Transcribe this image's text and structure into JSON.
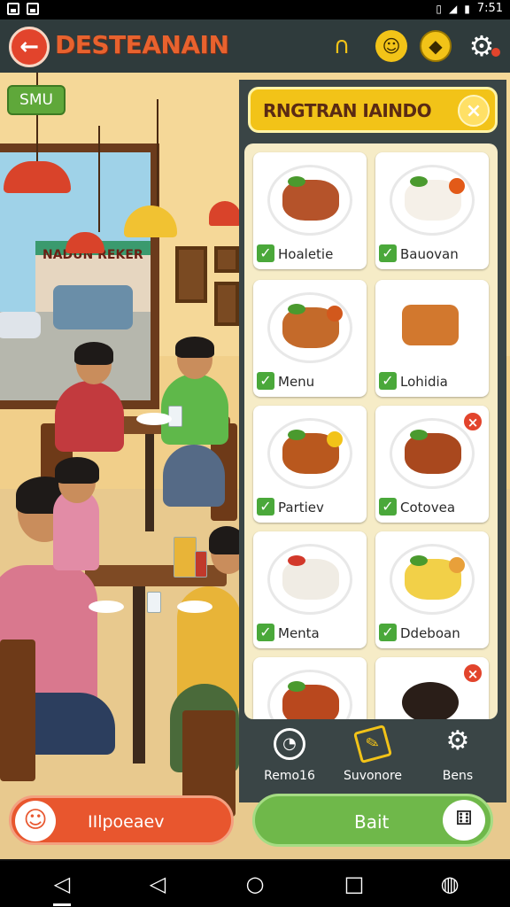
{
  "status_bar": {
    "time": "7:51",
    "icons": [
      "image-icon",
      "app-icon",
      "vibrate-icon",
      "signal-icon",
      "battery-icon"
    ]
  },
  "header": {
    "title": "DESTEANAIN",
    "icons": [
      "back-arrow-icon",
      "headphones-icon",
      "smile-icon",
      "tag-icon",
      "gear-icon"
    ],
    "badge_color": "#e2442c",
    "accent": "#e8622e"
  },
  "scene": {
    "sign_label": "SMU",
    "shop_sign": "NADUN REKER"
  },
  "panel": {
    "title": "RNGTRAN IAINDO",
    "close_label": "×",
    "items": [
      {
        "label": "Hoaletie",
        "removable": false
      },
      {
        "label": "Bauovan",
        "removable": false
      },
      {
        "label": "Menu",
        "removable": false
      },
      {
        "label": "Lohidia",
        "removable": false
      },
      {
        "label": "Partiev",
        "removable": false
      },
      {
        "label": "Cotovea",
        "removable": true
      },
      {
        "label": "Menta",
        "removable": false
      },
      {
        "label": "Ddeboan",
        "removable": false
      },
      {
        "label": "",
        "removable": false
      },
      {
        "label": "",
        "removable": true
      }
    ],
    "tools": [
      {
        "label": "Remo16",
        "icon": "clock-icon"
      },
      {
        "label": "Suvonore",
        "icon": "card-icon"
      },
      {
        "label": "Bens",
        "icon": "gear-icon"
      }
    ]
  },
  "bottom": {
    "left_button": "IIlpoeaev",
    "right_button": "Bait",
    "right_icon": "dice-icon"
  },
  "colors": {
    "panel_bg": "#3a4546",
    "panel_header": "#f2c318",
    "left_button": "#e8562e",
    "right_button": "#6fb84a"
  }
}
